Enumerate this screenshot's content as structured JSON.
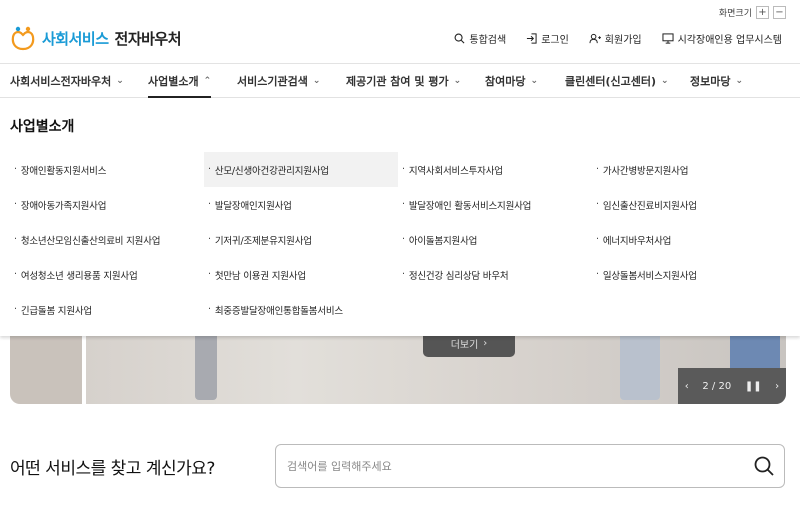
{
  "utility": {
    "zoom_label": "화면크기",
    "zoom_in": "+",
    "zoom_out": "−"
  },
  "header": {
    "brand": "사회서비스",
    "brand_sub": "전자바우처",
    "top_menu": [
      {
        "label": "통합검색",
        "icon": "search-icon"
      },
      {
        "label": "로그인",
        "icon": "login-icon"
      },
      {
        "label": "회원가입",
        "icon": "user-add-icon"
      },
      {
        "label": "시각장애인용 업무시스템",
        "icon": "monitor-icon"
      }
    ]
  },
  "gnb": [
    {
      "label": "사회서비스전자바우처",
      "chevron": "⌄"
    },
    {
      "label": "사업별소개",
      "chevron": "⌃"
    },
    {
      "label": "서비스기관검색",
      "chevron": "⌄"
    },
    {
      "label": "제공기관 참여 및 평가",
      "chevron": "⌄"
    },
    {
      "label": "참여마당",
      "chevron": "⌄"
    },
    {
      "label": "클린센터(신고센터)",
      "chevron": "⌄"
    },
    {
      "label": "정보마당",
      "chevron": "⌄"
    }
  ],
  "dropdown": {
    "title": "사업별소개",
    "items": [
      "장애인활동지원서비스",
      "산모/신생아건강관리지원사업",
      "지역사회서비스투자사업",
      "가사간병방문지원사업",
      "장애아동가족지원사업",
      "발달장애인지원사업",
      "발달장애인 활동서비스지원사업",
      "임신출산진료비지원사업",
      "청소년산모임신출산의료비 지원사업",
      "기저귀/조제분유지원사업",
      "아이돌봄지원사업",
      "에너지바우처사업",
      "여성청소년 생리용품 지원사업",
      "첫만남 이용권 지원사업",
      "정신건강 심리상담 바우처",
      "일상돌봄서비스지원사업",
      "긴급돌봄 지원사업",
      "최중증발달장애인통합돌봄서비스"
    ]
  },
  "hero": {
    "more_label": "더보기",
    "pager": {
      "prev": "‹",
      "current": "2 / 20",
      "pause": "❚❚",
      "next": "›"
    }
  },
  "search": {
    "question": "어떤 서비스를 찾고 계신가요?",
    "placeholder": "검색어를 입력해주세요"
  },
  "colors": {
    "brand": "#1a9bd6",
    "logo_orange": "#f39a1e"
  }
}
